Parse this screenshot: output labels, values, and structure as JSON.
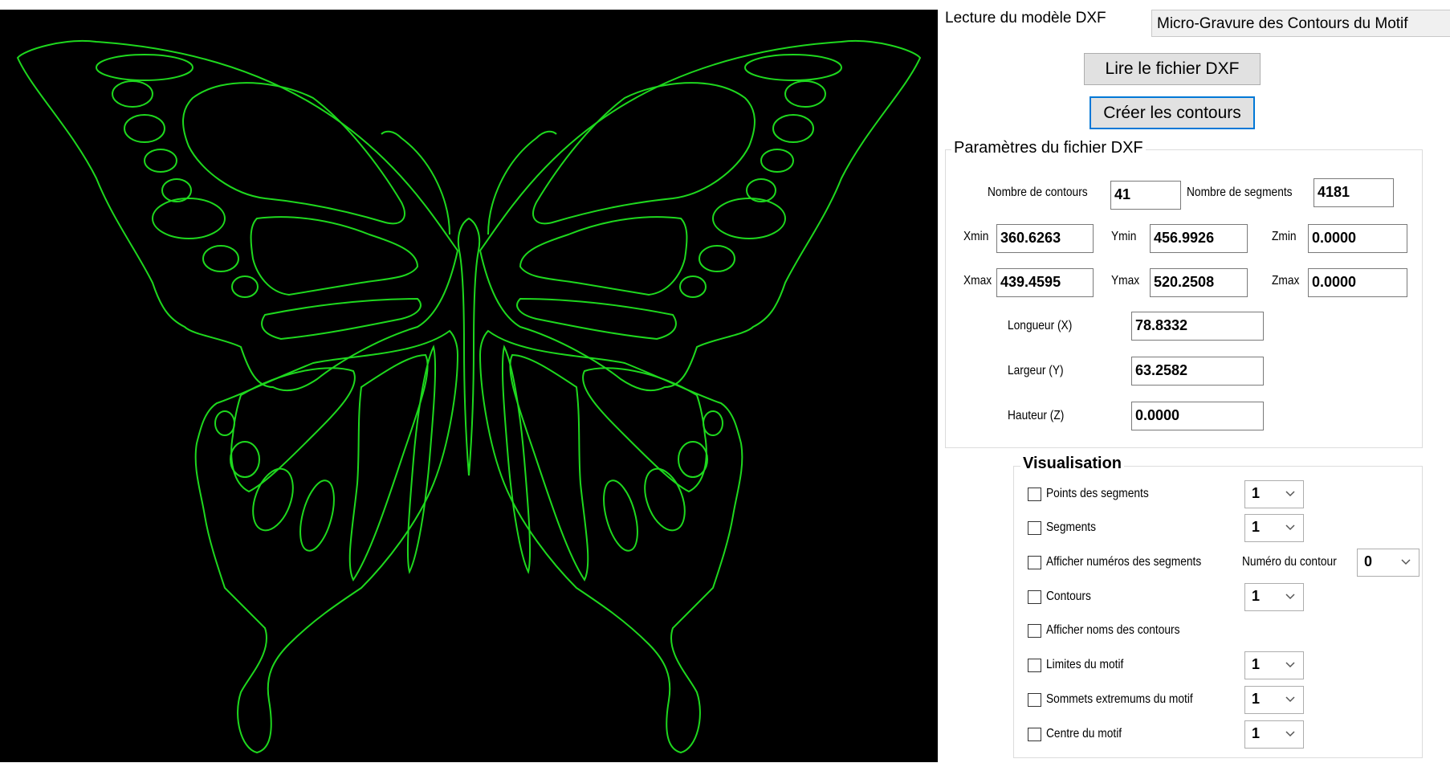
{
  "header": {
    "title": "Lecture du modèle DXF",
    "tab_label": "Micro-Gravure des Contours du Motif"
  },
  "buttons": {
    "read_dxf": "Lire le fichier DXF",
    "create_contours": "Créer les contours"
  },
  "dxf_params": {
    "group_title": "Paramètres du fichier DXF",
    "nb_contours_label": "Nombre de contours",
    "nb_contours": "41",
    "nb_segments_label": "Nombre de segments",
    "nb_segments": "4181",
    "xmin_label": "Xmin",
    "xmin": "360.6263",
    "ymin_label": "Ymin",
    "ymin": "456.9926",
    "zmin_label": "Zmin",
    "zmin": "0.0000",
    "xmax_label": "Xmax",
    "xmax": "439.4595",
    "ymax_label": "Ymax",
    "ymax": "520.2508",
    "zmax_label": "Zmax",
    "zmax": "0.0000",
    "length_label": "Longueur (X)",
    "length": "78.8332",
    "width_label": "Largeur (Y)",
    "width": "63.2582",
    "height_label": "Hauteur (Z)",
    "height": "0.0000"
  },
  "visualisation": {
    "group_title": "Visualisation",
    "items": [
      {
        "label": "Points des segments",
        "checked": false,
        "combo": "1"
      },
      {
        "label": "Segments",
        "checked": false,
        "combo": "1"
      },
      {
        "label": "Afficher numéros des segments",
        "checked": false
      },
      {
        "label": "Contours",
        "checked": false,
        "combo": "1"
      },
      {
        "label": "Afficher noms des contours",
        "checked": false
      },
      {
        "label": "Limites du motif",
        "checked": false,
        "combo": "1"
      },
      {
        "label": "Sommets extremums du motif",
        "checked": false,
        "combo": "1"
      },
      {
        "label": "Centre du motif",
        "checked": false,
        "combo": "1"
      }
    ],
    "contour_number_label": "Numéro du contour",
    "contour_number": "0"
  },
  "canvas": {
    "background": "#000000",
    "stroke_color": "#1ed81e"
  },
  "colors": {
    "focus_border": "#0078d7",
    "button_bg": "#e1e1e1"
  }
}
